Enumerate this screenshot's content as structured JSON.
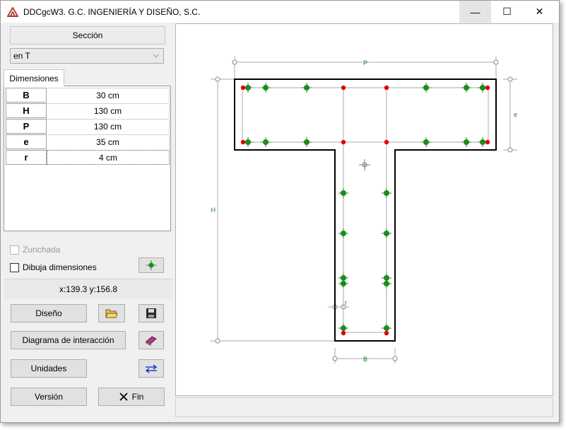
{
  "window": {
    "title": "DDCgcW3. G.C. INGENIERÍA Y DISEÑO, S.C."
  },
  "titlebar": {
    "minimize": "—",
    "maximize": "☐",
    "close": "✕"
  },
  "section": {
    "header_label": "Sección",
    "type_value": "en T",
    "tab_label": "Dimensiones"
  },
  "dimensions": [
    {
      "key": "B",
      "value": "30 cm"
    },
    {
      "key": "H",
      "value": "130 cm"
    },
    {
      "key": "P",
      "value": "130 cm"
    },
    {
      "key": "e",
      "value": "35 cm"
    },
    {
      "key": "r",
      "value": "4 cm"
    }
  ],
  "options": {
    "zunchada_label": "Zunchada",
    "zunchada_checked": false,
    "dibuja_label": "Dibuja dimensiones",
    "dibuja_checked": false
  },
  "coords_text": "x:139.3 y:156.8",
  "buttons": {
    "diseno": "Diseño",
    "diagrama": "Diagrama de interacción",
    "unidades": "Unidades",
    "version": "Versión",
    "fin": "Fin"
  },
  "drawing": {
    "labels": {
      "P": "P",
      "e": "e",
      "H": "H",
      "B": "B",
      "r": "r"
    },
    "colors": {
      "outline": "#000000",
      "dim_line": "#a8a8a8",
      "bar_green": "#1e8a1e",
      "bar_red": "#e00000",
      "label": "#208020"
    }
  },
  "icons": {
    "open": "folder-open-icon",
    "save": "floppy-disk-icon",
    "book": "book-icon",
    "units": "arrows-icon",
    "bar": "rebar-icon",
    "close": "close-icon"
  }
}
